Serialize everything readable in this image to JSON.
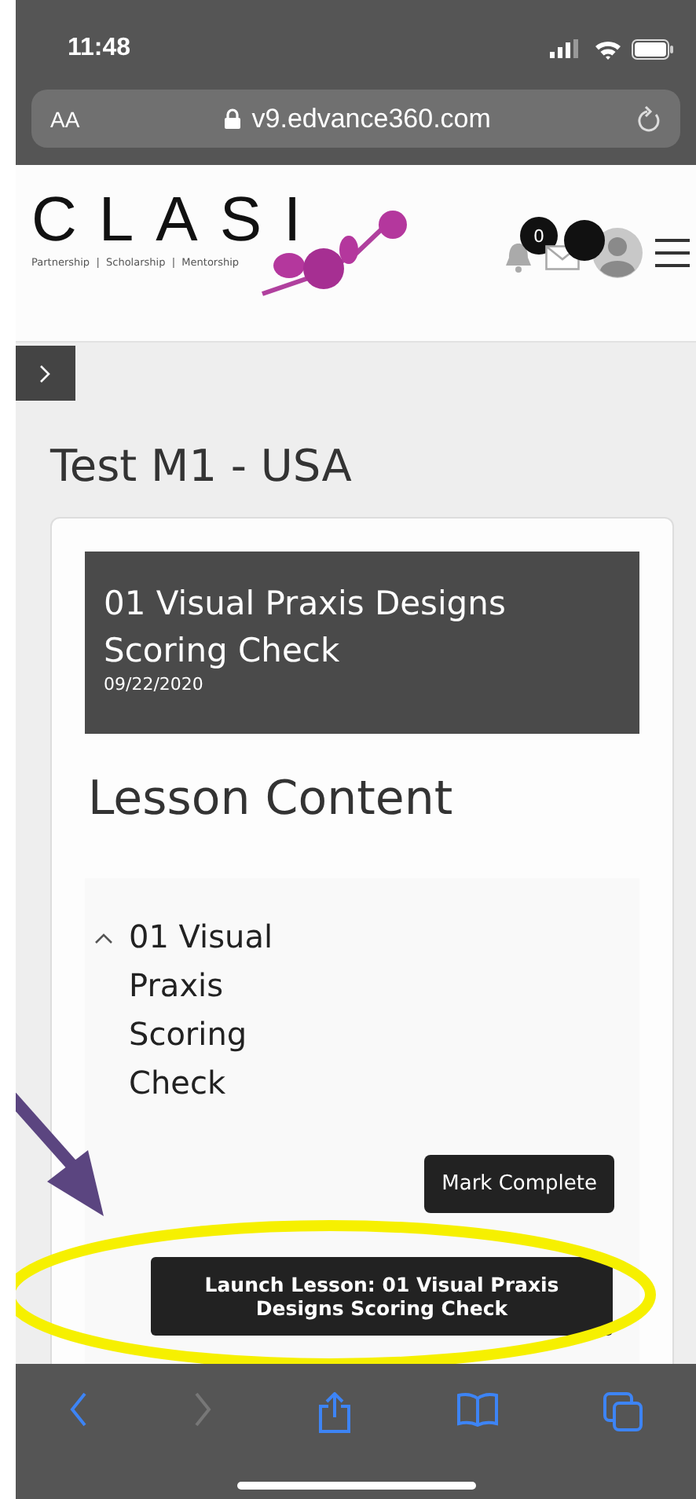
{
  "status_bar": {
    "time": "11:48"
  },
  "address_bar": {
    "text_size": "AA",
    "url": "v9.edvance360.com"
  },
  "header": {
    "logo": "CLASI",
    "tagline": "Partnership  |  Scholarship  |  Mentorship",
    "notification_count": "0"
  },
  "page": {
    "title": "Test M1 - USA"
  },
  "lesson": {
    "title": "01 Visual Praxis Designs Scoring Check",
    "date": "09/22/2020",
    "section_heading": "Lesson Content",
    "items": [
      {
        "title": "01 Visual Praxis Scoring Check",
        "expanded": true,
        "button": "Mark Complete",
        "launch": "Launch Lesson:  01 Visual Praxis Designs Scoring Check"
      }
    ]
  }
}
